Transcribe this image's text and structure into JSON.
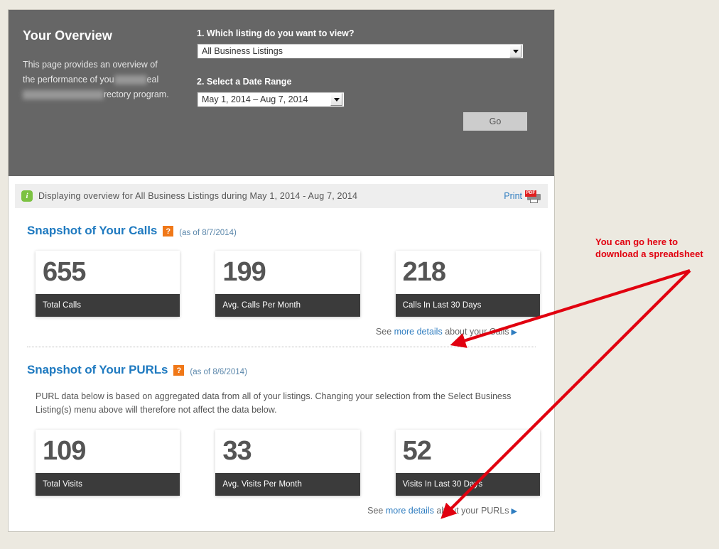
{
  "header": {
    "title": "Your Overview",
    "intro_line1": "This page provides an overview of",
    "intro_line2_a": "the performance of you",
    "intro_line2_b": "eal",
    "intro_line3_b": "rectory program.",
    "listing_label": "1. Which listing do you want to view?",
    "listing_value": "All Business Listings",
    "daterange_label": "2. Select a Date Range",
    "daterange_value": "May 1, 2014 – Aug 7, 2014",
    "go_label": "Go"
  },
  "status_bar": {
    "info_icon": "info-icon",
    "text": "Displaying overview for All Business Listings during May 1, 2014 - Aug 7, 2014",
    "print_label": "Print",
    "pdf_badge": "PDF"
  },
  "calls_section": {
    "title": "Snapshot of Your Calls",
    "help_badge": "?",
    "as_of": "(as of 8/7/2014)",
    "cards": [
      {
        "value": "655",
        "label": "Total Calls"
      },
      {
        "value": "199",
        "label": "Avg. Calls Per Month"
      },
      {
        "value": "218",
        "label": "Calls In Last 30 Days"
      }
    ],
    "more_prefix": "See ",
    "more_link": "more details",
    "more_suffix": " about your Calls",
    "more_caret": "▶"
  },
  "purls_section": {
    "title": "Snapshot of Your PURLs",
    "help_badge": "?",
    "as_of": "(as of 8/6/2014)",
    "note": "PURL data below is based on aggregated data from all of your listings. Changing your selection from the Select Business Listing(s) menu above will therefore not affect the data below.",
    "cards": [
      {
        "value": "109",
        "label": "Total Visits"
      },
      {
        "value": "33",
        "label": "Avg. Visits Per Month"
      },
      {
        "value": "52",
        "label": "Visits In Last 30 Days"
      }
    ],
    "more_prefix": "See ",
    "more_link": "more details",
    "more_suffix": " about your PURLs",
    "more_caret": "▶"
  },
  "annotation": {
    "text": "You can go here to download a spreadsheet",
    "color": "#e1000f"
  }
}
